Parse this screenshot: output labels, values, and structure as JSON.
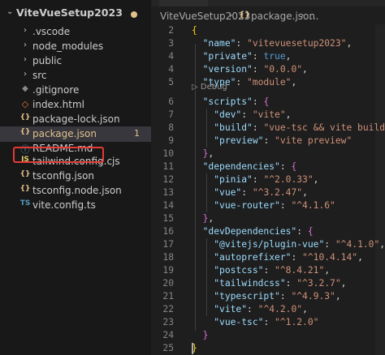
{
  "explorer": {
    "root": "ViteVueSetup2023",
    "items": [
      {
        "icon": "chevron-right-icon",
        "glyph": "›",
        "label": ".vscode",
        "badge": ""
      },
      {
        "icon": "chevron-right-icon",
        "glyph": "›",
        "label": "node_modules",
        "badge": ""
      },
      {
        "icon": "chevron-right-icon",
        "glyph": "›",
        "label": "public",
        "badge": ""
      },
      {
        "icon": "chevron-right-icon",
        "glyph": "›",
        "label": "src",
        "badge": ""
      },
      {
        "icon": "git-icon",
        "glyph": "◆",
        "label": ".gitignore",
        "badge": ""
      },
      {
        "icon": "html-icon",
        "glyph": "◇",
        "label": "index.html",
        "badge": ""
      },
      {
        "icon": "json-icon",
        "glyph": "{}",
        "label": "package-lock.json",
        "badge": ""
      },
      {
        "icon": "json-icon",
        "glyph": "{}",
        "label": "package.json",
        "badge": "1"
      },
      {
        "icon": "info-icon",
        "glyph": "ⓘ",
        "label": "README.md",
        "badge": ""
      },
      {
        "icon": "js-icon",
        "glyph": "JS",
        "label": "tailwind.config.cjs",
        "badge": ""
      },
      {
        "icon": "json-icon",
        "glyph": "{}",
        "label": "tsconfig.json",
        "badge": ""
      },
      {
        "icon": "json-icon",
        "glyph": "{}",
        "label": "tsconfig.node.json",
        "badge": ""
      },
      {
        "icon": "ts-icon",
        "glyph": "TS",
        "label": "vite.config.ts",
        "badge": ""
      }
    ]
  },
  "breadcrumb": {
    "folder": "ViteVueSetup2023",
    "separator": "›",
    "json_glyph": "{}",
    "file": "package.json",
    "more": "..."
  },
  "codelens": "▷ Debug",
  "code": [
    {
      "n": "2",
      "html": "<span class='br1'>{</span>"
    },
    {
      "n": "3",
      "html": "  <span class='k'>\"name\"</span><span class='p'>: </span><span class='s'>\"vitevuesetup2023\"</span><span class='p'>,</span>"
    },
    {
      "n": "4",
      "html": "  <span class='k'>\"private\"</span><span class='p'>: </span><span class='b'>true</span><span class='p'>,</span>"
    },
    {
      "n": "4",
      "html": "  <span class='k'>\"version\"</span><span class='p'>: </span><span class='s'>\"0.0.0\"</span><span class='p'>,</span>"
    },
    {
      "n": "5",
      "html": "  <span class='k'>\"type\"</span><span class='p'>: </span><span class='s'>\"module\"</span><span class='p'>,</span>"
    },
    {
      "n": "6",
      "html": "  <span class='k'>\"scripts\"</span><span class='p'>: </span><span class='br2'>{</span>"
    },
    {
      "n": "7",
      "html": "    <span class='k'>\"dev\"</span><span class='p'>: </span><span class='s'>\"vite\"</span><span class='p'>,</span>"
    },
    {
      "n": "8",
      "html": "    <span class='k'>\"build\"</span><span class='p'>: </span><span class='s'>\"vue-tsc &amp;&amp; vite build\"</span><span class='p'>,</span>"
    },
    {
      "n": "9",
      "html": "    <span class='k'>\"preview\"</span><span class='p'>: </span><span class='s'>\"vite preview\"</span>"
    },
    {
      "n": "10",
      "html": "  <span class='br2'>}</span><span class='p'>,</span>"
    },
    {
      "n": "11",
      "html": "  <span class='k'>\"dependencies\"</span><span class='p'>: </span><span class='br2'>{</span>"
    },
    {
      "n": "12",
      "html": "    <span class='k'>\"pinia\"</span><span class='p'>: </span><span class='s'>\"^2.0.33\"</span><span class='p'>,</span>"
    },
    {
      "n": "13",
      "html": "    <span class='k'>\"vue\"</span><span class='p'>: </span><span class='s'>\"^3.2.47\"</span><span class='p'>,</span>"
    },
    {
      "n": "14",
      "html": "    <span class='k'>\"vue-router\"</span><span class='p'>: </span><span class='s'>\"^4.1.6\"</span>"
    },
    {
      "n": "15",
      "html": "  <span class='br2'>}</span><span class='p'>,</span>"
    },
    {
      "n": "16",
      "html": "  <span class='k'>\"devDependencies\"</span><span class='p'>: </span><span class='br2'>{</span>"
    },
    {
      "n": "17",
      "html": "    <span class='k'>\"@vitejs/plugin-vue\"</span><span class='p'>: </span><span class='s'>\"^4.1.0\"</span><span class='p'>,</span>"
    },
    {
      "n": "18",
      "html": "    <span class='k'>\"autoprefixer\"</span><span class='p'>: </span><span class='s'>\"^10.4.14\"</span><span class='p'>,</span>"
    },
    {
      "n": "19",
      "html": "    <span class='k'>\"postcss\"</span><span class='p'>: </span><span class='s'>\"^8.4.21\"</span><span class='p'>,</span>"
    },
    {
      "n": "20",
      "html": "    <span class='k'>\"tailwindcss\"</span><span class='p'>: </span><span class='s'>\"^3.2.7\"</span><span class='p'>,</span>"
    },
    {
      "n": "21",
      "html": "    <span class='k'>\"typescript\"</span><span class='p'>: </span><span class='s'>\"^4.9.3\"</span><span class='p'>,</span>"
    },
    {
      "n": "22",
      "html": "    <span class='k'>\"vite\"</span><span class='p'>: </span><span class='s'>\"^4.2.0\"</span><span class='p'>,</span>"
    },
    {
      "n": "23",
      "html": "    <span class='k'>\"vue-tsc\"</span><span class='p'>: </span><span class='s'>\"^1.2.0\"</span>"
    },
    {
      "n": "24",
      "html": "  <span class='br2'>}</span>"
    },
    {
      "n": "25",
      "html": "<span class='br1'>}</span>"
    },
    {
      "n": "26",
      "html": ""
    }
  ],
  "colors": {
    "accent": "#e2c08d",
    "highlight_box": "#e53935"
  }
}
